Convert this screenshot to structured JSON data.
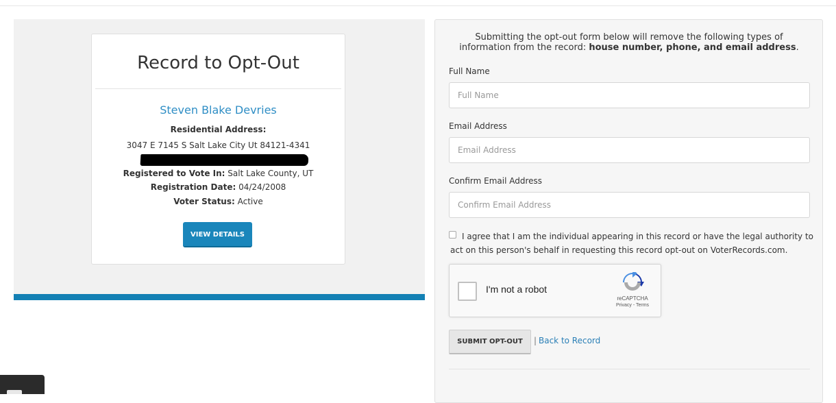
{
  "record_card": {
    "title": "Record to Opt-Out",
    "name": "Steven Blake Devries",
    "residential_address_label": "Residential Address:",
    "residential_address": "3047 E 7145 S Salt Lake City Ut 84121-4341",
    "registered_label": "Registered to Vote In:",
    "registered_value": "Salt Lake County, UT",
    "registration_date_label": "Registration Date:",
    "registration_date": "04/24/2008",
    "voter_status_label": "Voter Status:",
    "voter_status": "Active",
    "view_details_label": "VIEW DETAILS"
  },
  "form": {
    "intro_text": "Submitting the opt-out form below will remove the following types of information from the record:",
    "intro_bold": "house number, phone, and email address",
    "intro_end": ".",
    "full_name_label": "Full Name",
    "full_name_placeholder": "Full Name",
    "email_label": "Email Address",
    "email_placeholder": "Email Address",
    "confirm_email_label": "Confirm Email Address",
    "confirm_email_placeholder": "Confirm Email Address",
    "agree_line1": "I agree that I am the individual appearing in this record or have the legal authority to",
    "agree_line2": "act on this person's behalf in requesting this record opt-out on VoterRecords.com.",
    "recaptcha_label": "I'm not a robot",
    "recaptcha_brand": "reCAPTCHA",
    "recaptcha_links": "Privacy - Terms",
    "submit_label": "SUBMIT OPT-OUT",
    "separator": "|",
    "back_link": "Back to Record"
  },
  "colors": {
    "accent_blue": "#1380b4",
    "link_blue": "#2f8ec5",
    "panel_gray": "#f1f1f1"
  }
}
